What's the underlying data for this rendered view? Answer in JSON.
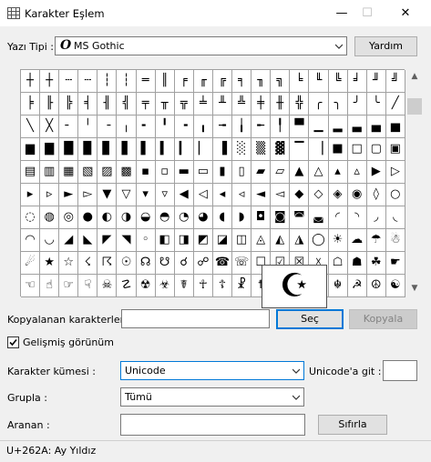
{
  "window": {
    "title": "Karakter Eşlem",
    "minimize": "—",
    "maximize": "☐",
    "close": "✕"
  },
  "font": {
    "label": "Yazı Tipi :",
    "value": "MS Gothic",
    "help_button": "Yardım"
  },
  "grid": {
    "rows": [
      [
        "┼",
        "┼",
        "┄",
        "┄",
        "┆",
        "┆",
        "═",
        "║",
        "╒",
        "╓",
        "╔",
        "╕",
        "╖",
        "╗",
        "╘",
        "╙",
        "╚",
        "╛",
        "╜",
        "╝"
      ],
      [
        "╞",
        "╟",
        "╠",
        "╡",
        "╢",
        "╣",
        "╤",
        "╥",
        "╦",
        "╧",
        "╨",
        "╩",
        "╪",
        "╫",
        "╬",
        "╭",
        "╮",
        "╯",
        "╰",
        "╱"
      ],
      [
        "╲",
        "╳",
        "╴",
        "╵",
        "╶",
        "╷",
        "╸",
        "╹",
        "╺",
        "╻",
        "╼",
        "╽",
        "╾",
        "╿",
        "▀",
        "▁",
        "▂",
        "▃",
        "▄",
        "▅"
      ],
      [
        "▆",
        "▇",
        "█",
        "▉",
        "▊",
        "▋",
        "▌",
        "▍",
        "▎",
        "▏",
        "▐",
        "░",
        "▒",
        "▓",
        "▔",
        "▕",
        "■",
        "□",
        "▢",
        "▣"
      ],
      [
        "▤",
        "▥",
        "▦",
        "▧",
        "▨",
        "▩",
        "▪",
        "▫",
        "▬",
        "▭",
        "▮",
        "▯",
        "▰",
        "▱",
        "▲",
        "△",
        "▴",
        "▵",
        "▶",
        "▷"
      ],
      [
        "▸",
        "▹",
        "►",
        "▻",
        "▼",
        "▽",
        "▾",
        "▿",
        "◀",
        "◁",
        "◂",
        "◃",
        "◄",
        "◅",
        "◆",
        "◇",
        "◈",
        "◉",
        "◊",
        "○"
      ],
      [
        "◌",
        "◍",
        "◎",
        "●",
        "◐",
        "◑",
        "◒",
        "◓",
        "◔",
        "◕",
        "◖",
        "◗",
        "◘",
        "◙",
        "◚",
        "◛",
        "◜",
        "◝",
        "◞",
        "◟"
      ],
      [
        "◠",
        "◡",
        "◢",
        "◣",
        "◤",
        "◥",
        "◦",
        "◧",
        "◨",
        "◩",
        "◪",
        "◫",
        "◬",
        "◭",
        "◮",
        "◯",
        "☀",
        "☁",
        "☂",
        "☃"
      ],
      [
        "☄",
        "★",
        "☆",
        "☇",
        "☈",
        "☉",
        "☊",
        "☋",
        "☌",
        "☍",
        "☎",
        "☏",
        "☐",
        "☑",
        "☒",
        "☓",
        "☖",
        "☗",
        "☘",
        "☛"
      ],
      [
        "☜",
        "☝",
        "☞",
        "☟",
        "☠",
        "☡",
        "☢",
        "☣",
        "☤",
        "☥",
        "☦",
        "☧",
        "☨",
        "☩",
        "☪",
        "☫",
        "☬",
        "☭",
        "☮",
        "☯"
      ]
    ],
    "zoomed_char": "☪"
  },
  "copy": {
    "label": "Kopyalanan karakterler :",
    "value": "",
    "select_button": "Seç",
    "copy_button": "Kopyala"
  },
  "advanced": {
    "label": "Gelişmiş görünüm",
    "checked": true
  },
  "charset": {
    "label": "Karakter kümesi :",
    "value": "Unicode",
    "goto_label": "Unicode'a git :",
    "goto_value": ""
  },
  "group": {
    "label": "Grupla :",
    "value": "Tümü"
  },
  "search": {
    "label": "Aranan :",
    "value": "",
    "reset_button": "Sıfırla"
  },
  "status": {
    "text": "U+262A: Ay Yıldız"
  },
  "colors": {
    "focus": "#0078d7",
    "grid_line": "#a0a0a0"
  }
}
